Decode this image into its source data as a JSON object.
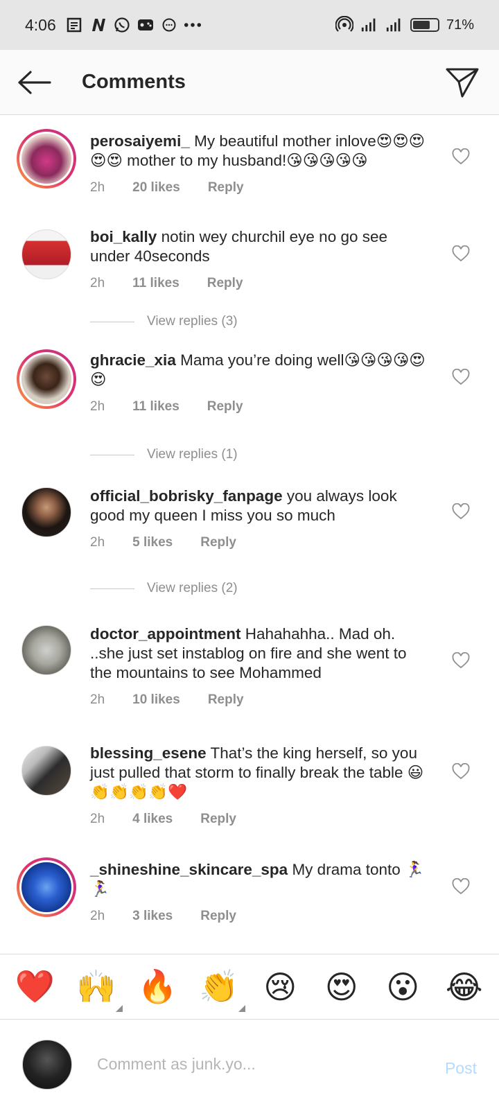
{
  "status_bar": {
    "time": "4:06",
    "battery": "71%",
    "battery_level": 0.71
  },
  "header": {
    "title": "Comments"
  },
  "comments": [
    {
      "username": "perosaiyemi_",
      "text": "My beautiful mother inlove😍😍😍😍😍 mother to my husband!😘😘😘😘😘",
      "time": "2h",
      "likes": "20 likes",
      "reply": "Reply"
    },
    {
      "username": "boi_kally",
      "text": "notin wey churchil eye no go see under 40seconds",
      "time": "2h",
      "likes": "11 likes",
      "reply": "Reply",
      "view_replies": "View replies (3)"
    },
    {
      "username": "ghracie_xia",
      "text": "Mama you’re doing well😘😘😘😘😍😍",
      "time": "2h",
      "likes": "11 likes",
      "reply": "Reply",
      "view_replies": "View replies (1)"
    },
    {
      "username": "official_bobrisky_fanpage",
      "text": "you always look good my queen I miss you so much",
      "time": "2h",
      "likes": "5 likes",
      "reply": "Reply",
      "view_replies": "View replies (2)"
    },
    {
      "username": "doctor_appointment",
      "text": "Hahahahha.. Mad oh. ..she just  set instablog on fire and she went to the mountains to see Mohammed",
      "time": "2h",
      "likes": "10 likes",
      "reply": "Reply"
    },
    {
      "username": "blessing_esene",
      "text": "That’s the king herself, so you just pulled that storm to finally break the table 😃👏👏👏👏❤️",
      "time": "2h",
      "likes": "4 likes",
      "reply": "Reply"
    },
    {
      "username": "_shineshine_skincare_spa",
      "text": "My drama tonto 🏃‍♀️🏃‍♀️",
      "time": "2h",
      "likes": "3 likes",
      "reply": "Reply"
    }
  ],
  "quick_emojis": [
    "❤️",
    "🙌",
    "🔥",
    "👏",
    "😢",
    "😍",
    "😮",
    "😂"
  ],
  "composer": {
    "placeholder": "Comment as junk.yo...",
    "post_label": "Post"
  }
}
